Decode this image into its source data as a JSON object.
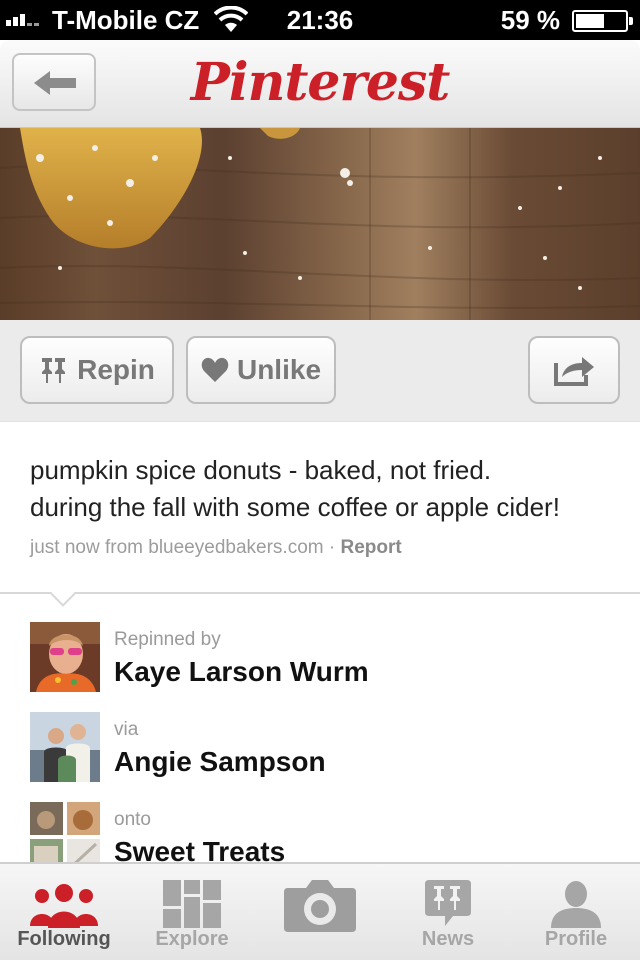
{
  "status_bar": {
    "carrier": "T-Mobile CZ",
    "time": "21:36",
    "battery_percent": "59 %",
    "battery_level": 0.59
  },
  "nav": {
    "logo_text": "Pinterest",
    "back_icon": "back-arrow-icon"
  },
  "actions": {
    "repin_label": "Repin",
    "unlike_label": "Unlike",
    "share_icon": "share-icon"
  },
  "pin": {
    "description_line1": "pumpkin spice donuts - baked, not fried.",
    "description_line2": "during the fall with some coffee or apple cider!",
    "meta_prefix": "just now from blueeyedbakers.com · ",
    "report_label": "Report"
  },
  "attribution": {
    "repinned_by_label": "Repinned by",
    "repinned_by_name": "Kaye Larson Wurm",
    "via_label": "via",
    "via_name": "Angie Sampson",
    "onto_label": "onto",
    "board_name": "Sweet Treats"
  },
  "tabs": [
    {
      "label": "Following",
      "icon": "people-icon",
      "active": true
    },
    {
      "label": "Explore",
      "icon": "grid-icon",
      "active": false
    },
    {
      "label": "",
      "icon": "camera-icon",
      "active": false
    },
    {
      "label": "News",
      "icon": "news-pin-icon",
      "active": false
    },
    {
      "label": "Profile",
      "icon": "person-icon",
      "active": false
    }
  ],
  "colors": {
    "brand_red": "#cb2027",
    "button_text": "#787878",
    "tab_inactive": "#a6a6a6"
  }
}
